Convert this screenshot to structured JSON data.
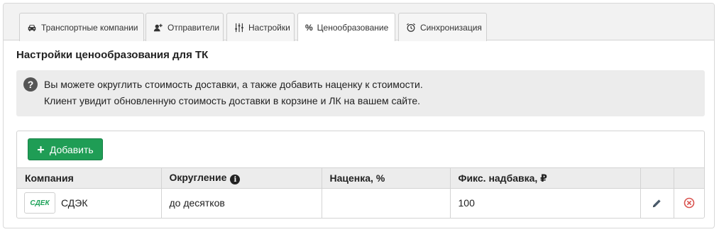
{
  "tabs": [
    {
      "label": "Транспортные компании",
      "icon": "car-icon"
    },
    {
      "label": "Отправители",
      "icon": "user-add-icon"
    },
    {
      "label": "Настройки",
      "icon": "sliders-icon"
    },
    {
      "label": "Ценообразование",
      "icon": "percent-icon",
      "symbol": "%",
      "active": true
    },
    {
      "label": "Синхронизация",
      "icon": "sync-clock-icon"
    }
  ],
  "page_title": "Настройки ценообразования для ТК",
  "info": {
    "icon_symbol": "?",
    "line1": "Вы можете округлить стоимость доставки, а также добавить наценку к стоимости.",
    "line2": "Клиент увидит обновленную стоимость доставки в корзине и ЛК на вашем сайте."
  },
  "add_button": {
    "symbol": "+",
    "label": "Добавить",
    "color": "#1f9d55"
  },
  "table": {
    "headers": {
      "company": "Компания",
      "rounding": "Округление",
      "rounding_info": "i",
      "markup": "Наценка, %",
      "fixed": "Фикс. надбавка, ₽"
    },
    "rows": [
      {
        "logo_text": "СДЕК",
        "company": "СДЭК",
        "rounding": "до десятков",
        "markup": "",
        "fixed": "100"
      }
    ]
  },
  "colors": {
    "delete": "#d9534f",
    "edit": "#4a5b6b"
  }
}
